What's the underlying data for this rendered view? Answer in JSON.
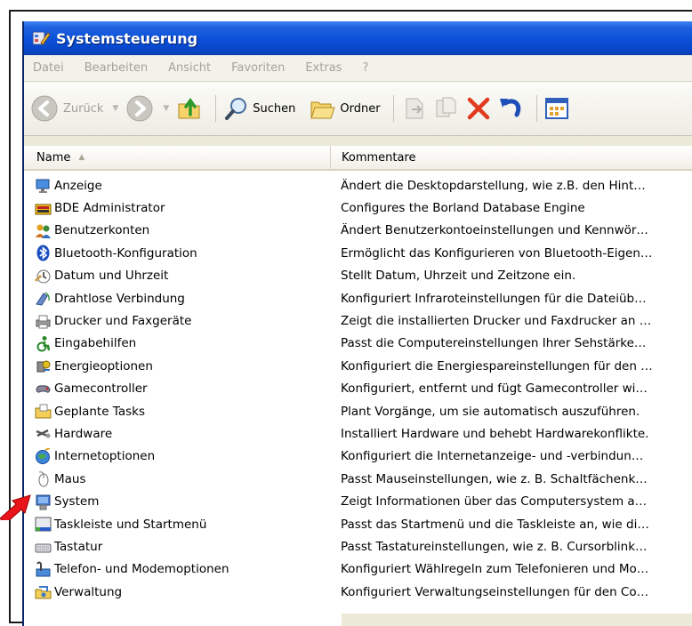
{
  "window": {
    "title": "Systemsteuerung"
  },
  "menu": [
    "Datei",
    "Bearbeiten",
    "Ansicht",
    "Favoriten",
    "Extras",
    "?"
  ],
  "toolbar": {
    "back_label": "Zurück",
    "search_label": "Suchen",
    "folders_label": "Ordner"
  },
  "columns": {
    "name": "Name",
    "comment": "Kommentare"
  },
  "items": [
    {
      "name": "Anzeige",
      "comment": "Ändert die Desktopdarstellung, wie z.B. den Hint…",
      "icon": "display-icon"
    },
    {
      "name": "BDE Administrator",
      "comment": "Configures the Borland Database Engine",
      "icon": "database-icon"
    },
    {
      "name": "Benutzerkonten",
      "comment": "Ändert Benutzerkontoeinstellungen und Kennwör…",
      "icon": "users-icon"
    },
    {
      "name": "Bluetooth-Konfiguration",
      "comment": "Ermöglicht das Konfigurieren von Bluetooth-Eigen…",
      "icon": "bluetooth-icon"
    },
    {
      "name": "Datum und Uhrzeit",
      "comment": "Stellt Datum, Uhrzeit und Zeitzone ein.",
      "icon": "clock-icon"
    },
    {
      "name": "Drahtlose Verbindung",
      "comment": "Konfiguriert Infraroteinstellungen für die Dateiüb…",
      "icon": "wireless-icon"
    },
    {
      "name": "Drucker und Faxgeräte",
      "comment": "Zeigt die installierten Drucker und Faxdrucker an …",
      "icon": "printer-icon"
    },
    {
      "name": "Eingabehilfen",
      "comment": "Passt die Computereinstellungen Ihrer Sehstärke…",
      "icon": "accessibility-icon"
    },
    {
      "name": "Energieoptionen",
      "comment": "Konfiguriert die Energiespareinstellungen für den …",
      "icon": "power-icon"
    },
    {
      "name": "Gamecontroller",
      "comment": "Konfiguriert, entfernt und fügt Gamecontroller wi…",
      "icon": "gamepad-icon"
    },
    {
      "name": "Geplante Tasks",
      "comment": "Plant Vorgänge, um sie automatisch auszuführen.",
      "icon": "scheduled-tasks-icon"
    },
    {
      "name": "Hardware",
      "comment": "Installiert Hardware und behebt Hardwarekonflikte.",
      "icon": "hardware-icon"
    },
    {
      "name": "Internetoptionen",
      "comment": "Konfiguriert die Internetanzeige- und -verbindun…",
      "icon": "globe-icon"
    },
    {
      "name": "Maus",
      "comment": "Passt Mauseinstellungen, wie z. B. Schaltfächenk…",
      "icon": "mouse-icon"
    },
    {
      "name": "System",
      "comment": "Zeigt Informationen über das Computersystem a…",
      "icon": "system-icon"
    },
    {
      "name": "Taskleiste und Startmenü",
      "comment": "Passt das Startmenü und die Taskleiste an, wie di…",
      "icon": "taskbar-icon"
    },
    {
      "name": "Tastatur",
      "comment": "Passt Tastatureinstellungen, wie z. B. Cursorblink…",
      "icon": "keyboard-icon"
    },
    {
      "name": "Telefon- und Modemoptionen",
      "comment": "Konfiguriert Wählregeln zum Telefonieren und Mo…",
      "icon": "phone-icon"
    },
    {
      "name": "Verwaltung",
      "comment": "Konfiguriert Verwaltungseinstellungen für den Co…",
      "icon": "admin-tools-icon"
    }
  ]
}
